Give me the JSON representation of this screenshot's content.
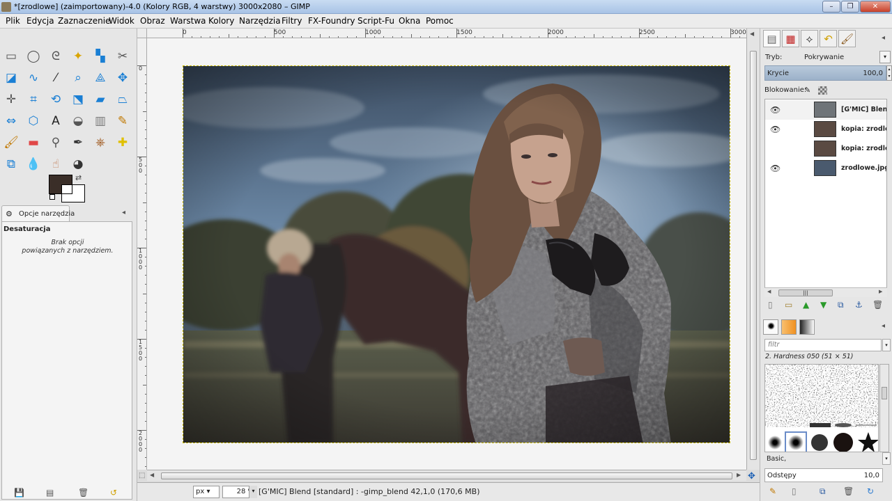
{
  "window": {
    "title": "*[zrodlowe] (zaimportowany)-4.0 (Kolory RGB, 4 warstwy) 3000x2080 – GIMP",
    "controls": {
      "minimize": "–",
      "restore": "❐",
      "close": "✕"
    }
  },
  "menu": [
    "Plik",
    "Edycja",
    "Zaznaczenie",
    "Widok",
    "Obraz",
    "Warstwa",
    "Kolory",
    "Narzędzia",
    "Filtry",
    "FX-Foundry",
    "Script-Fu",
    "Okna",
    "Pomoc"
  ],
  "toolbox": {
    "tools": [
      {
        "name": "rect-select",
        "glyph": "▭",
        "color": "#555"
      },
      {
        "name": "ellipse-select",
        "glyph": "◯",
        "color": "#555"
      },
      {
        "name": "free-select",
        "glyph": "ᘓ",
        "color": "#555"
      },
      {
        "name": "fuzzy-select",
        "glyph": "✦",
        "color": "#d9a400"
      },
      {
        "name": "color-select",
        "glyph": "▚",
        "color": "#1a7fd4"
      },
      {
        "name": "scissors",
        "glyph": "✂",
        "color": "#555"
      },
      {
        "name": "foreground-select",
        "glyph": "◪",
        "color": "#1a7fd4"
      },
      {
        "name": "paths",
        "glyph": "∿",
        "color": "#1a7fd4"
      },
      {
        "name": "color-picker",
        "glyph": "⁄",
        "color": "#333"
      },
      {
        "name": "zoom",
        "glyph": "⌕",
        "color": "#1a7fd4"
      },
      {
        "name": "measure",
        "glyph": "⟁",
        "color": "#1a7fd4"
      },
      {
        "name": "move",
        "glyph": "✥",
        "color": "#1a7fd4"
      },
      {
        "name": "align",
        "glyph": "✛",
        "color": "#555"
      },
      {
        "name": "crop",
        "glyph": "⌗",
        "color": "#1a7fd4"
      },
      {
        "name": "rotate",
        "glyph": "⟲",
        "color": "#1a7fd4"
      },
      {
        "name": "scale",
        "glyph": "⬔",
        "color": "#1a7fd4"
      },
      {
        "name": "shear",
        "glyph": "▰",
        "color": "#1a7fd4"
      },
      {
        "name": "perspective",
        "glyph": "⏢",
        "color": "#1a7fd4"
      },
      {
        "name": "flip",
        "glyph": "⇔",
        "color": "#1a7fd4"
      },
      {
        "name": "cage",
        "glyph": "⬡",
        "color": "#1a7fd4"
      },
      {
        "name": "text",
        "glyph": "A",
        "color": "#222"
      },
      {
        "name": "bucket-fill",
        "glyph": "◒",
        "color": "#555"
      },
      {
        "name": "blend",
        "glyph": "▥",
        "color": "#777"
      },
      {
        "name": "pencil",
        "glyph": "✎",
        "color": "#c07800"
      },
      {
        "name": "paintbrush",
        "glyph": "🖌",
        "color": "#c07800"
      },
      {
        "name": "eraser",
        "glyph": "▬",
        "color": "#e04848"
      },
      {
        "name": "airbrush",
        "glyph": "⚲",
        "color": "#555"
      },
      {
        "name": "ink",
        "glyph": "✒",
        "color": "#333"
      },
      {
        "name": "clone",
        "glyph": "⎈",
        "color": "#a05a20"
      },
      {
        "name": "heal",
        "glyph": "✚",
        "color": "#e0c000"
      },
      {
        "name": "perspective-clone",
        "glyph": "⧉",
        "color": "#1a7fd4"
      },
      {
        "name": "blur",
        "glyph": "💧",
        "color": "#1a7fd4"
      },
      {
        "name": "smudge",
        "glyph": "☝",
        "color": "#c07850"
      },
      {
        "name": "dodge-burn",
        "glyph": "◕",
        "color": "#333"
      }
    ],
    "fg_color": "#3a2e28",
    "bg_color": "#ffffff"
  },
  "tool_options": {
    "tab_label": "Opcje narzędzia",
    "tool_name": "Desaturacja",
    "no_options": "Brak opcji\npowiązanych z narzędziem."
  },
  "ruler_top": [
    "0",
    "500",
    "1000",
    "1500",
    "2000",
    "2500",
    "3000"
  ],
  "ruler_left": [
    "0",
    "5\n0\n0",
    "1\n0\n0\n0",
    "1\n5\n0\n0",
    "2\n0\n0\n0"
  ],
  "statusbar": {
    "unit": "px",
    "zoom": "28 %",
    "message": "[G'MIC] Blend [standard] : -gimp_blend 42,1,0 (170,6 MB)"
  },
  "layers_panel": {
    "mode_label": "Tryb:",
    "mode_value": "Pokrywanie",
    "opacity_label": "Krycie",
    "opacity_value": "100,0",
    "lock_label": "Blokowanie:",
    "layers": [
      {
        "name": "[G'MIC] Blend [",
        "visible": true,
        "selected": true,
        "thumb": "#6f7478"
      },
      {
        "name": "kopia: zrodlowe",
        "visible": true,
        "selected": false,
        "thumb": "#5a4a42"
      },
      {
        "name": "kopia: zrodlowe",
        "visible": false,
        "selected": false,
        "thumb": "#5a4a42"
      },
      {
        "name": "zrodlowe.jpg",
        "visible": true,
        "selected": false,
        "thumb": "#4a5a6e"
      }
    ]
  },
  "brushes_panel": {
    "filter_placeholder": "filtr",
    "brush_name": "2. Hardness 050 (51 × 51)",
    "tag": "Basic,",
    "spacing_label": "Odstępy",
    "spacing_value": "10,0"
  }
}
